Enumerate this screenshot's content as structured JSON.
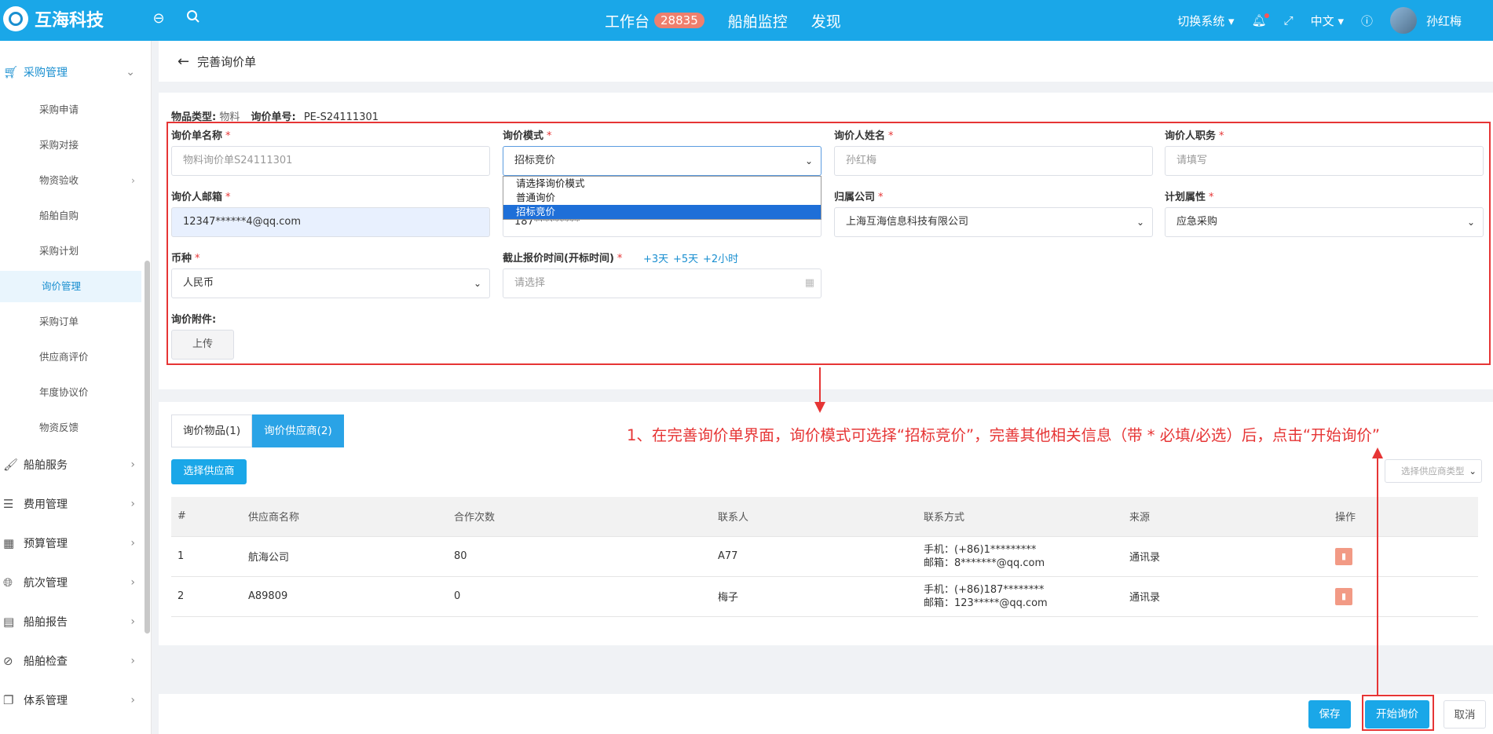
{
  "topbar": {
    "logo_text": "互海科技",
    "nav": [
      {
        "label": "工作台",
        "badge": "28835"
      },
      {
        "label": "船舶监控"
      },
      {
        "label": "发现"
      }
    ],
    "switch_system": "切换系统",
    "language": "中文",
    "user_name": "孙红梅"
  },
  "sidebar": {
    "group_open": "采购管理",
    "sub_items": [
      "采购申请",
      "采购对接",
      "物资验收",
      "船舶自购",
      "采购计划",
      "询价管理",
      "采购订单",
      "供应商评价",
      "年度协议价",
      "物资反馈"
    ],
    "groups": [
      "船舶服务",
      "费用管理",
      "预算管理",
      "航次管理",
      "船舶报告",
      "船舶检查",
      "体系管理"
    ]
  },
  "header": {
    "title": "完善询价单"
  },
  "form": {
    "item_type_label": "物品类型:",
    "item_type_value": "物料",
    "inquiry_no_label": "询价单号:",
    "inquiry_no_value": "PE-S24111301",
    "name_label": "询价单名称",
    "name_value": "物料询价单S24111301",
    "mode_label": "询价模式",
    "mode_value": "招标竞价",
    "inquirer_label": "询价人姓名",
    "inquirer_value": "孙红梅",
    "position_label": "询价人职务",
    "position_placeholder": "请填写",
    "email_label": "询价人邮箱",
    "email_value": "12347******4@qq.com",
    "phone_partial": "187*********",
    "company_label": "归属公司",
    "company_value": "上海互海信息科技有限公司",
    "plan_label": "计划属性",
    "plan_value": "应急采购",
    "currency_label": "币种",
    "currency_value": "人民币",
    "deadline_label": "截止报价时间(开标时间)",
    "deadline_placeholder": "请选择",
    "quick_options": [
      "+3天",
      "+5天",
      "+2小时"
    ],
    "attachment_label": "询价附件:",
    "upload_label": "上传",
    "required_mark": "*"
  },
  "dropdown": {
    "options": [
      "请选择询价模式",
      "普通询价",
      "招标竞价"
    ],
    "selected_index": 2
  },
  "supplier_section": {
    "tabs": [
      "询价物品(1)",
      "询价供应商(2)"
    ],
    "active_tab": 1,
    "select_button": "选择供应商",
    "type_filter_placeholder": "选择供应商类型",
    "annotation": "1、在完善询价单界面，询价模式可选择“招标竞价”，完善其他相关信息（带 * 必填/必选）后，点击“开始询价”",
    "columns": [
      "#",
      "供应商名称",
      "合作次数",
      "联系人",
      "联系方式",
      "来源",
      "操作"
    ],
    "rows": [
      {
        "no": "1",
        "name": "航海公司",
        "times": "80",
        "contact": "A77",
        "phone": "手机：(+86)1*********",
        "email": "邮箱：8*******@qq.com",
        "source": "通讯录"
      },
      {
        "no": "2",
        "name": "A89809",
        "times": "0",
        "contact": "梅子",
        "phone": "手机：(+86)187********",
        "email": "邮箱：123*****@qq.com",
        "source": "通讯录"
      }
    ]
  },
  "footer": {
    "save": "保存",
    "start": "开始询价",
    "cancel": "取消"
  },
  "colors": {
    "primary": "#1aa7e8",
    "annotation": "#e63535",
    "badge": "#ef7f6d"
  }
}
